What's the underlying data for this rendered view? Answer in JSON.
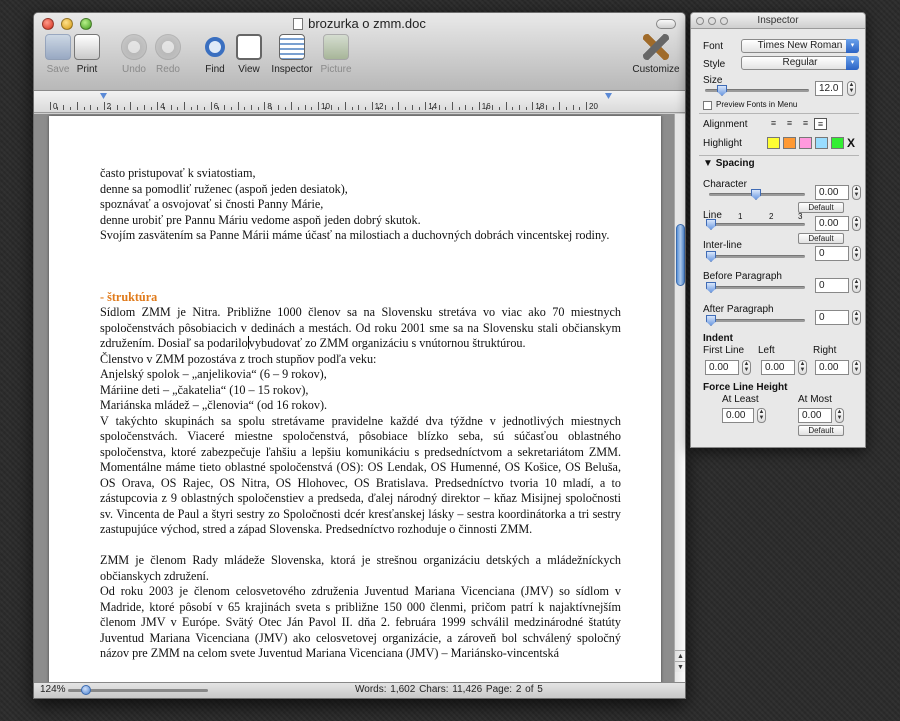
{
  "window": {
    "title": "brozurka o zmm.doc"
  },
  "toolbar": {
    "save": "Save",
    "print": "Print",
    "undo": "Undo",
    "redo": "Redo",
    "find": "Find",
    "view": "View",
    "inspector": "Inspector",
    "picture": "Picture",
    "customize": "Customize"
  },
  "ruler": {
    "labels": [
      "0",
      "2",
      "4",
      "6",
      "8",
      "10",
      "12",
      "14",
      "16",
      "18",
      "20"
    ]
  },
  "document": {
    "lines_top": [
      "často pristupovať k sviatostiam,",
      "denne sa pomodliť ruženec (aspoň jeden desiatok),",
      "spoznávať a osvojovať si čnosti Panny Márie,",
      "denne urobiť pre Pannu Máriu vedome aspoň jeden dobrý skutok."
    ],
    "para_svojim": "Svojím zasvätením sa Panne Márii máme účasť na milostiach a duchovných dobrách vincentskej rodiny.",
    "heading_struktura": "- štruktúra",
    "para_sidlom_a": "Sídlom ZMM je Nitra. Približne 1000 členov sa na Slovensku stretáva vo viac ako 70 miestnych spoločenstvách pôsobiacich v dedinách a mestách. Od roku 2001 sme sa na Slovensku stali občianskym združením. Dosiaľ sa podarilo",
    "para_sidlom_b": "vybudovať zo ZMM organizáciu s vnútornou štruktúrou.",
    "line_clenstvo": "Členstvo v ZMM pozostáva z troch stupňov podľa veku:",
    "line_anjelsky": "Anjelský spolok – „anjelikovia“ (6 – 9 rokov),",
    "line_mariine": "Máriine deti – „čakatelia“ (10 – 15 rokov),",
    "line_marianska": "Mariánska mládež – „členovia“ (od 16 rokov).",
    "para_v_takychto": "V takýchto skupinách sa spolu stretávame pravidelne každé dva týždne v jednotlivých miestnych spoločenstvách. Viaceré miestne spoločenstvá, pôsobiace blízko seba, sú súčasťou oblastného spoločenstva, ktoré zabezpečuje ľahšiu a lepšiu komunikáciu s predsedníctvom a sekretariátom ZMM. Momentálne máme tieto oblastné spoločenstvá (OS): OS Lendak, OS Humenné, OS Košice, OS Beluša, OS Orava, OS Rajec, OS Nitra, OS Hlohovec, OS Bratislava. Predsedníctvo tvoria 10 mladí, a to zástupcovia z 9 oblastných spoločenstiev a predseda, ďalej národný direktor – kňaz Misijnej spoločnosti sv. Vincenta de Paul a štyri sestry zo Spoločnosti dcér kresťanskej lásky – sestra koordinátorka a tri sestry zastupujúce východ, stred a západ Slovenska. Predsedníctvo rozhoduje o činnosti ZMM.",
    "para_zmm_clenom": "ZMM je členom Rady mládeže Slovenska, ktorá je strešnou organizáciu detských a mládežníckych občianskych združení.",
    "para_od_roku_2003": "Od roku 2003 je členom celosvetového združenia Juventud Mariana Vicenciana (JMV) so sídlom v Madride, ktoré pôsobí v 65 krajinách sveta s približne 150 000 členmi, pričom patrí k najaktívnejším členom JMV v Európe. Svätý Otec Ján Pavol II. dňa 2. februára 1999 schválil medzinárodné štatúty Juventud Mariana Vicenciana (JMV) ako celosvetovej organizácie, a zároveň bol schválený spoločný názov pre ZMM na celom svete Juventud Mariana Vicenciana (JMV) – Mariánsko-vincentská"
  },
  "statusbar": {
    "zoom": "124%",
    "zoom_fraction": 0.1,
    "info": "Words: 1,602  Chars: 11,426  Page: 2 of 5"
  },
  "inspector": {
    "title": "Inspector",
    "font_label": "Font",
    "font_value": "Times New Roman",
    "style_label": "Style",
    "style_value": "Regular",
    "size_label": "Size",
    "size_value": "12.0",
    "preview_fonts": "Preview Fonts in Menu",
    "alignment_label": "Alignment",
    "highlight_label": "Highlight",
    "highlight_colors": [
      "#ffff33",
      "#ff9933",
      "#ff99dd",
      "#99ddff",
      "#33ee33"
    ],
    "highlight_clear": "X",
    "spacing_label": "Spacing",
    "character_label": "Character",
    "character_value": "0.00",
    "default_label": "Default",
    "line_label": "Line",
    "line_ticks": [
      "1",
      "2",
      "3"
    ],
    "line_value": "0.00",
    "interline_label": "Inter-line",
    "interline_value": "0",
    "before_label": "Before Paragraph",
    "before_value": "0",
    "after_label": "After Paragraph",
    "after_value": "0",
    "indent_label": "Indent",
    "first_line_label": "First Line",
    "left_label": "Left",
    "right_label": "Right",
    "first_line_value": "0.00",
    "left_value": "0.00",
    "right_value": "0.00",
    "force_label": "Force Line Height",
    "at_least_label": "At Least",
    "at_most_label": "At Most",
    "at_least_value": "0.00",
    "at_most_value": "0.00"
  }
}
